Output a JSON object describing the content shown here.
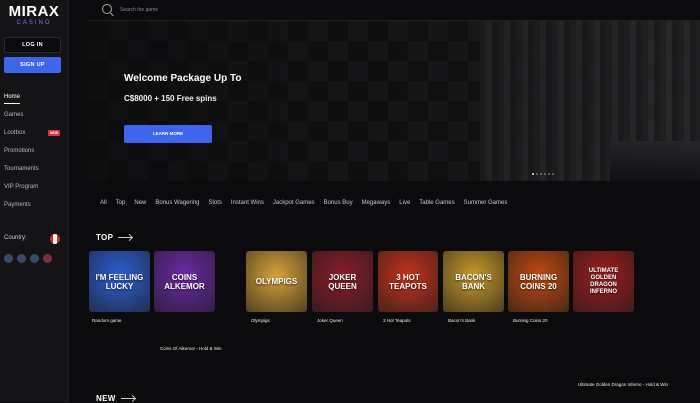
{
  "brand": {
    "name": "MIRAX",
    "tagline": "CASINO"
  },
  "auth": {
    "login": "LOG IN",
    "signup": "SIGN UP"
  },
  "nav": [
    {
      "label": "Home",
      "active": true
    },
    {
      "label": "Games"
    },
    {
      "label": "Lootbox",
      "badge": "NEW"
    },
    {
      "label": "Promotions"
    },
    {
      "label": "Tournaments"
    },
    {
      "label": "VIP Program"
    },
    {
      "label": "Payments"
    }
  ],
  "country": {
    "label": "Country:"
  },
  "search": {
    "placeholder": "Search the game"
  },
  "hero": {
    "title": "Welcome Package Up To",
    "subtitle": "C$8000 + 150 Free spins",
    "button": "LEARN MORE"
  },
  "categories": [
    "All",
    "Top",
    "New",
    "Bonus Wagering",
    "Slots",
    "Instant Wins",
    "Jackpot Games",
    "Bonus Buy",
    "Megaways",
    "Live",
    "Table Games",
    "Summer Games"
  ],
  "sections": {
    "top": "TOP",
    "new": "NEW"
  },
  "games": [
    {
      "tile": "I'M FEELING LUCKY",
      "label": "Random game",
      "color": "#2f5fd6"
    },
    {
      "tile": "COINS ALKEMOR",
      "label": "Coins Of Alkemor - Hold & Win",
      "color": "#6b2aa6"
    },
    {
      "tile": "OLYMPIGS",
      "label": "Olympigs",
      "color": "#d8a238"
    },
    {
      "tile": "JOKER QUEEN",
      "label": "Joker Queen",
      "color": "#8a1d2a"
    },
    {
      "tile": "3 HOT TEAPOTS",
      "label": "3 Hot Teapots",
      "color": "#c5331e"
    },
    {
      "tile": "BACON'S BANK",
      "label": "Bacon's Bank",
      "color": "#c79a2a"
    },
    {
      "tile": "BURNING COINS 20",
      "label": "Burning Coins 20",
      "color": "#c04a10"
    },
    {
      "tile": "ULTIMATE GOLDEN DRAGON INFERNO",
      "label": "Ultimate Golden Dragon Inferno - Hold & Win",
      "color": "#9e1e1e"
    }
  ]
}
